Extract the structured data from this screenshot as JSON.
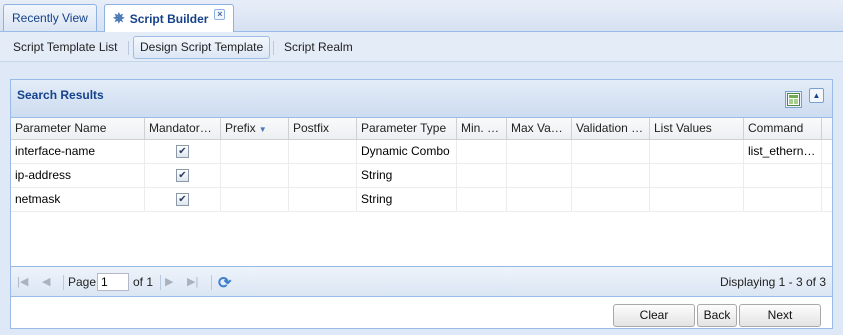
{
  "tabs": [
    {
      "label": "Recently View",
      "active": false
    },
    {
      "label": "Script Builder",
      "active": true,
      "closable": true
    }
  ],
  "subnav": [
    {
      "label": "Script Template List",
      "selected": false
    },
    {
      "label": "Design Script Template",
      "selected": true
    },
    {
      "label": "Script Realm",
      "selected": false
    }
  ],
  "panel": {
    "title": "Search Results"
  },
  "grid": {
    "columns": [
      "Parameter Name",
      "Mandator…",
      "Prefix",
      "Postfix",
      "Parameter Type",
      "Min. …",
      "Max Va…",
      "Validation …",
      "List Values",
      "Command"
    ],
    "sorted_column": "Prefix",
    "rows": [
      {
        "name": "interface-name",
        "mandatory": true,
        "prefix": "",
        "postfix": "",
        "type": "Dynamic Combo",
        "min": "",
        "max": "",
        "validation": "",
        "list_values": "",
        "command": "list_ethern…"
      },
      {
        "name": "ip-address",
        "mandatory": true,
        "prefix": "",
        "postfix": "",
        "type": "String",
        "min": "",
        "max": "",
        "validation": "",
        "list_values": "",
        "command": ""
      },
      {
        "name": "netmask",
        "mandatory": true,
        "prefix": "",
        "postfix": "",
        "type": "String",
        "min": "",
        "max": "",
        "validation": "",
        "list_values": "",
        "command": ""
      }
    ]
  },
  "pager": {
    "page_label": "Page",
    "page_value": "1",
    "of_label": "of 1",
    "displaying": "Displaying 1 - 3 of 3"
  },
  "buttons": {
    "clear": "Clear",
    "back": "Back",
    "next": "Next"
  },
  "icons": {
    "tab_gear": "gear-icon",
    "checkbox": "✔"
  },
  "colors": {
    "accent": "#15428b",
    "border": "#99bbe8"
  }
}
